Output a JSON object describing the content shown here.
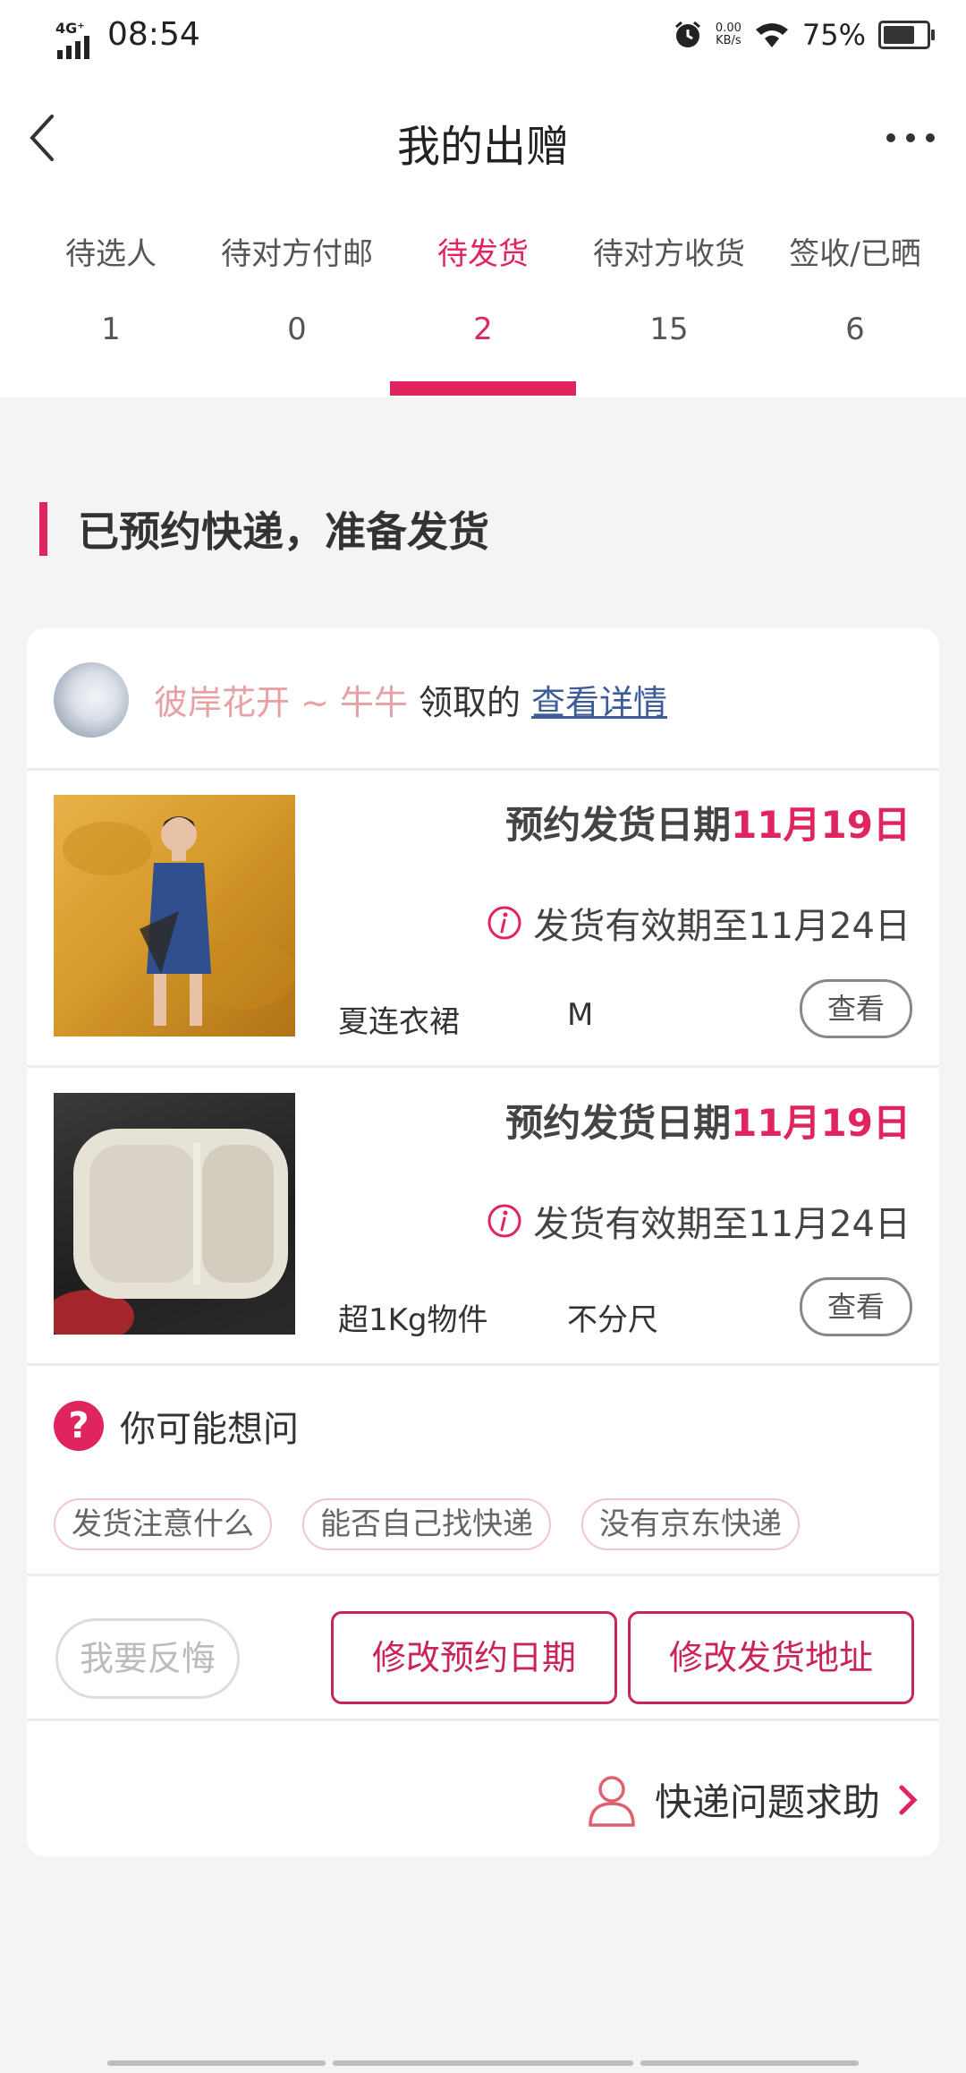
{
  "status_bar": {
    "network": "4G⁺",
    "time": "08:54",
    "speed_value": "0.00",
    "speed_unit": "KB/s",
    "battery": "75%"
  },
  "header": {
    "title": "我的出赠",
    "back_icon": "chevron-left-icon",
    "more_icon": "more-dots-icon"
  },
  "tabs": [
    {
      "label": "待选人",
      "count": "1"
    },
    {
      "label": "待对方付邮",
      "count": "0"
    },
    {
      "label": "待发货",
      "count": "2",
      "active": true
    },
    {
      "label": "待对方收货",
      "count": "15"
    },
    {
      "label": "签收/已晒",
      "count": "6"
    }
  ],
  "section": {
    "title": "已预约快递，准备发货"
  },
  "receiver": {
    "name": "彼岸花开 ~ 牛牛",
    "action": "领取的",
    "link": "查看详情"
  },
  "items": [
    {
      "date_prefix": "预约发货日期",
      "date": "11月19日",
      "valid_text": "发货有效期至11月24日",
      "name": "夏连衣裙",
      "size": "M",
      "view": "查看"
    },
    {
      "date_prefix": "预约发货日期",
      "date": "11月19日",
      "valid_text": "发货有效期至11月24日",
      "name": "超1Kg物件",
      "size": "不分尺",
      "view": "查看"
    }
  ],
  "faq": {
    "title": "你可能想问",
    "icon_text": "?",
    "chips": [
      "发货注意什么",
      "能否自己找快递",
      "没有京东快递"
    ]
  },
  "actions": {
    "regret": "我要反悔",
    "change_date": "修改预约日期",
    "change_address": "修改发货地址"
  },
  "help": {
    "label": "快递问题求助"
  },
  "colors": {
    "accent": "#e0245e",
    "button": "#c8235a",
    "link": "#3d5d99",
    "username": "#e9a0a5"
  }
}
